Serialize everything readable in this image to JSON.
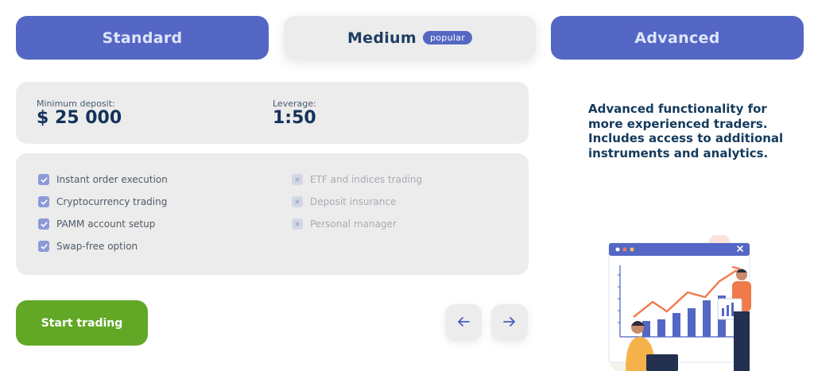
{
  "tabs": {
    "standard": "Standard",
    "medium": "Medium",
    "medium_badge": "popular",
    "advanced": "Advanced"
  },
  "summary": {
    "min_deposit_label": "Minimum deposit:",
    "min_deposit_value": "$ 25 000",
    "leverage_label": "Leverage:",
    "leverage_value": "1:50"
  },
  "features": {
    "included": [
      "Instant order execution",
      "Cryptocurrency trading",
      "PAMM account setup",
      "Swap-free option"
    ],
    "excluded": [
      "ETF and indices trading",
      "Deposit insurance",
      "Personal manager"
    ]
  },
  "description": "Advanced functionality for more experienced traders. Includes access to additional instruments and analytics.",
  "actions": {
    "start_trading": "Start trading",
    "prev_icon": "arrow-left-icon",
    "next_icon": "arrow-right-icon"
  },
  "colors": {
    "tab_blue": "#5467c4",
    "panel_grey": "#ececec",
    "cta_green": "#62a826",
    "heading_navy": "#143a5c"
  }
}
